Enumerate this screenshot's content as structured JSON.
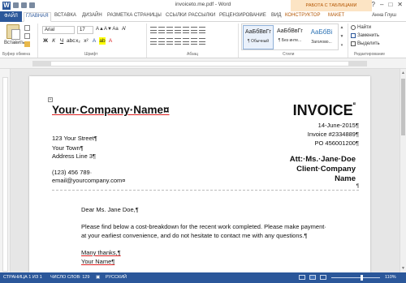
{
  "titlebar": {
    "title": "invoiceto.me.pdf - Word",
    "user": "Анна Глуш"
  },
  "ribbon_tabs": {
    "file": "ФАЙЛ",
    "home": "ГЛАВНАЯ",
    "insert": "ВСТАВКА",
    "design": "ДИЗАЙН",
    "layout": "РАЗМЕТКА СТРАНИЦЫ",
    "references": "ССЫЛКИ",
    "mailings": "РАССЫЛКИ",
    "review": "РЕЦЕНЗИРОВАНИЕ",
    "view": "ВИД",
    "constructor": "КОНСТРУКТОР",
    "layout2": "МАКЕТ",
    "context_header": "РАБОТА С ТАБЛИЦАМИ"
  },
  "clipboard": {
    "paste_label": "Вставить",
    "group_label": "Буфер обмена"
  },
  "font": {
    "font_name": "Arial",
    "font_size": "17",
    "group_label": "Шрифт",
    "bold": "Ж",
    "italic": "К",
    "underline": "Ч"
  },
  "paragraph": {
    "group_label": "Абзац"
  },
  "styles": {
    "group_label": "Стили",
    "items": [
      {
        "sample": "АаБбВвГг",
        "name": "¶ Обычный"
      },
      {
        "sample": "АаБбВвГг",
        "name": "¶ Без инте..."
      },
      {
        "sample": "АаБбВі",
        "name": "Заголово..."
      }
    ]
  },
  "editing": {
    "group_label": "Редактирование",
    "find": "Найти",
    "replace": "Заменить",
    "select": "Выделить"
  },
  "document": {
    "company_name": "Your·Company·Name¤",
    "invoice_title": "INVOICE",
    "invoice_mark": "¤",
    "address": [
      "123 Your Street¶",
      "Your Town¶",
      "Address Line 3¶"
    ],
    "phone": "(123) 456 789·",
    "email": "email@yourcompany.com¤",
    "date": "14-June-2015¶",
    "invoice_no": "Invoice #2334889¶",
    "po": "PO 456001200¶",
    "att_lines": [
      "Att:·Ms.·Jane·Doe",
      "Client·Company",
      "Name"
    ],
    "para_mark": "¶",
    "greeting": "Dear Ms. Jane Doe,¶",
    "body_lines": [
      "Please find below a cost-breakdown for the recent work completed. Please make payment·",
      "at your earliest convenience, and do not hesitate to contact me with any questions.¶"
    ],
    "closing": "Many thanks,¶",
    "signature": "Your Name¶"
  },
  "statusbar": {
    "page": "СТРАНИЦА 1 ИЗ 1",
    "words": "ЧИСЛО СЛОВ: 129",
    "language": "РУССКИЙ",
    "zoom": "110%"
  },
  "colors": {
    "accent": "#2b579a",
    "context_tab": "#b35500"
  }
}
